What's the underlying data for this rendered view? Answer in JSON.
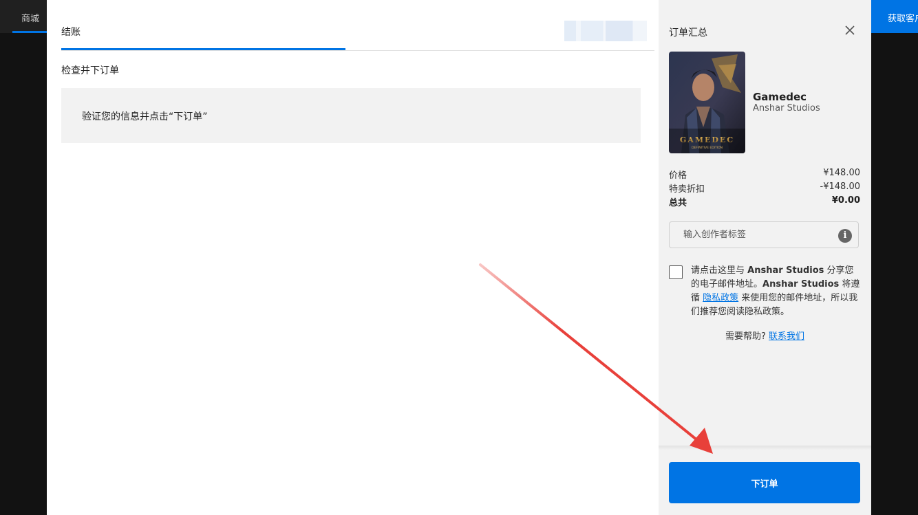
{
  "background": {
    "store_tab": "商城",
    "get_client": "获取客户端"
  },
  "checkout": {
    "tab_label": "结账",
    "section_title": "检查并下订单",
    "info_message": "验证您的信息并点击“下订单”"
  },
  "summary": {
    "title": "订单汇总",
    "game": {
      "name": "Gamedec",
      "publisher": "Anshar Studios",
      "cover_title": "GAMEDEC",
      "cover_subtitle": "DEFINITIVE EDITION"
    },
    "prices": [
      {
        "label": "价格",
        "value": "¥148.00",
        "bold": false
      },
      {
        "label": "特卖折扣",
        "value": "-¥148.00",
        "bold": false
      },
      {
        "label": "总共",
        "value": "¥0.00",
        "bold": true
      }
    ],
    "creator_tag_placeholder": "输入创作者标签",
    "consent": {
      "part1": "请点击这里与 ",
      "publisher1": "Anshar Studios",
      "part2": " 分享您的电子邮件地址。",
      "publisher2": "Anshar Studios",
      "part3": " 将遵循 ",
      "privacy_link": "隐私政策",
      "part4": " 来使用您的邮件地址，所以我们推荐您阅读隐私政策。"
    },
    "help_text": "需要帮助?",
    "contact_link": "联系我们",
    "place_order_label": "下订单"
  },
  "colors": {
    "accent": "#0074e4",
    "annotation_arrow": "#e8403a"
  }
}
